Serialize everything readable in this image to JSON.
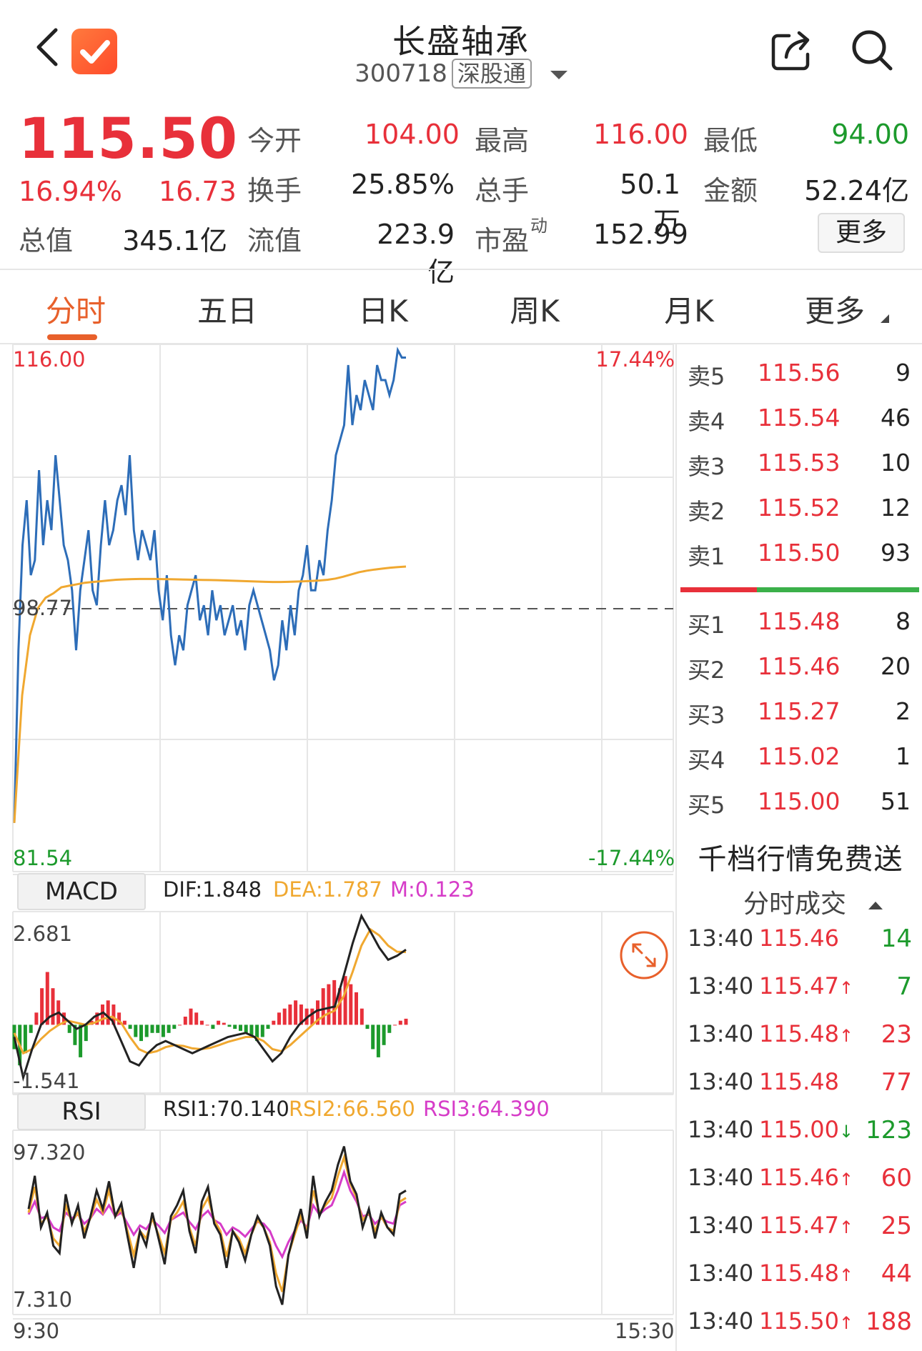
{
  "header": {
    "title": "长盛轴承",
    "code": "300718",
    "tag": "深股通"
  },
  "quote": {
    "price": "115.50",
    "pct_change": "16.94%",
    "change": "16.73",
    "total_mv_label": "总值",
    "total_mv": "345.1亿",
    "fields": [
      {
        "label": "今开",
        "value": "104.00",
        "color": "red"
      },
      {
        "label": "最高",
        "value": "116.00",
        "color": "red"
      },
      {
        "label": "最低",
        "value": "94.00",
        "color": "green"
      },
      {
        "label": "换手",
        "value": "25.85%",
        "color": "dark"
      },
      {
        "label": "总手",
        "value": "50.1万",
        "color": "dark"
      },
      {
        "label": "金额",
        "value": "52.24亿",
        "color": "dark"
      },
      {
        "label": "流值",
        "value": "223.9亿",
        "color": "dark"
      },
      {
        "label": "市盈",
        "value": "152.99",
        "color": "dark",
        "superscript": "动"
      }
    ],
    "more_button": "更多"
  },
  "tabs": [
    "分时",
    "五日",
    "日K",
    "周K",
    "月K",
    "更多"
  ],
  "active_tab": 0,
  "colors": {
    "up": "#e8303a",
    "down": "#1c9a2c",
    "accent": "#e8602b",
    "price_line": "#2d6db8",
    "avg_line": "#f0a830",
    "macd_m": "#d63cc8"
  },
  "intraday": {
    "y_max_label": "116.00",
    "y_min_label": "81.54",
    "pct_max_label": "17.44%",
    "pct_min_label": "-17.44%",
    "prev_close_label": "98.77",
    "time_start": "9:30",
    "time_end": "15:30",
    "prev_close": 98.77,
    "y_max": 116.0,
    "y_min": 81.54,
    "price": [
      84.5,
      96,
      103,
      106,
      101,
      102,
      108,
      103,
      106,
      104,
      109,
      106,
      103,
      102,
      100,
      96,
      100,
      102,
      104,
      100,
      99,
      103,
      106,
      103,
      104,
      106,
      107,
      105,
      109,
      104,
      102,
      104,
      103,
      102,
      104,
      100,
      98,
      101,
      97,
      95,
      97,
      96,
      99,
      100,
      101,
      98,
      99,
      97,
      100,
      98,
      99,
      97,
      98,
      99,
      97,
      98,
      96,
      99,
      100,
      99,
      98,
      97,
      96,
      94,
      95,
      98,
      96,
      99,
      97,
      100,
      101,
      103,
      100,
      100,
      102,
      101,
      104,
      106,
      109,
      110,
      111,
      115,
      111,
      113,
      112,
      114,
      113,
      112,
      115,
      114,
      114,
      113,
      114,
      116,
      115.5,
      115.5
    ],
    "avg": [
      84.5,
      93,
      97,
      98.8,
      99.5,
      99.8,
      100.2,
      100.3,
      100.4,
      100.5,
      100.55,
      100.6,
      100.65,
      100.7,
      100.72,
      100.74,
      100.75,
      100.75,
      100.75,
      100.74,
      100.73,
      100.72,
      100.71,
      100.7,
      100.69,
      100.68,
      100.67,
      100.65,
      100.63,
      100.61,
      100.6,
      100.58,
      100.56,
      100.55,
      100.55,
      100.56,
      100.58,
      100.6,
      100.62,
      100.65,
      100.7,
      100.78,
      100.9,
      101.05,
      101.2,
      101.3,
      101.38,
      101.44,
      101.5,
      101.54,
      101.58
    ]
  },
  "macd": {
    "tab_label": "MACD",
    "dif_label": "DIF:1.848",
    "dea_label": "DEA:1.787",
    "m_label": "M:0.123",
    "y_max_label": "2.681",
    "y_min_label": "-1.541",
    "y_max": 2.681,
    "y_min": -1.541,
    "hist": [
      -0.6,
      -1.0,
      -0.7,
      -0.2,
      0.3,
      0.9,
      1.3,
      0.9,
      0.6,
      0.3,
      -0.2,
      -0.5,
      -0.8,
      -0.4,
      0.1,
      0.3,
      0.5,
      0.6,
      0.5,
      0.3,
      0.1,
      -0.1,
      -0.3,
      -0.4,
      -0.3,
      -0.2,
      -0.2,
      -0.3,
      -0.2,
      -0.1,
      0.0,
      0.2,
      0.4,
      0.3,
      0.1,
      0.0,
      -0.1,
      0.1,
      0.05,
      -0.05,
      -0.1,
      -0.15,
      -0.2,
      -0.3,
      -0.4,
      -0.3,
      -0.1,
      0.1,
      0.3,
      0.4,
      0.5,
      0.6,
      0.5,
      0.4,
      0.4,
      0.6,
      0.9,
      1.0,
      1.1,
      0.9,
      1.2,
      1.0,
      0.8,
      0.4,
      -0.1,
      -0.6,
      -0.8,
      -0.5,
      -0.2,
      0.0,
      0.1,
      0.15
    ],
    "dif": [
      -0.3,
      -1.3,
      -0.6,
      0.0,
      0.2,
      0.3,
      0.1,
      -0.1,
      0.0,
      0.2,
      0.3,
      0.1,
      -0.4,
      -0.9,
      -1.0,
      -0.7,
      -0.5,
      -0.4,
      -0.5,
      -0.6,
      -0.7,
      -0.6,
      -0.5,
      -0.4,
      -0.3,
      -0.25,
      -0.2,
      -0.3,
      -0.6,
      -0.9,
      -0.7,
      -0.3,
      0.0,
      0.2,
      0.35,
      0.4,
      0.45,
      1.2,
      2.0,
      2.681,
      2.3,
      1.9,
      1.6,
      1.7,
      1.85
    ],
    "dea": [
      -0.2,
      -0.7,
      -0.6,
      -0.35,
      -0.15,
      0.0,
      0.1,
      0.05,
      0.0,
      0.05,
      0.15,
      0.2,
      0.05,
      -0.3,
      -0.6,
      -0.7,
      -0.65,
      -0.55,
      -0.5,
      -0.52,
      -0.58,
      -0.6,
      -0.57,
      -0.5,
      -0.42,
      -0.36,
      -0.3,
      -0.3,
      -0.4,
      -0.6,
      -0.65,
      -0.5,
      -0.3,
      -0.1,
      0.1,
      0.25,
      0.35,
      0.7,
      1.3,
      1.95,
      2.35,
      2.2,
      1.95,
      1.8,
      1.79
    ]
  },
  "rsi": {
    "tab_label": "RSI",
    "rsi1_label": "RSI1:70.140",
    "rsi2_label": "RSI2:66.560",
    "rsi3_label": "RSI3:64.390",
    "y_max_label": "97.320",
    "y_min_label": "7.310",
    "y_max": 97.32,
    "y_min": 7.31,
    "rsi1": [
      60,
      78,
      50,
      58,
      40,
      36,
      68,
      52,
      62,
      44,
      56,
      70,
      60,
      75,
      56,
      63,
      45,
      28,
      48,
      40,
      58,
      44,
      30,
      56,
      62,
      70,
      48,
      36,
      64,
      72,
      52,
      46,
      28,
      48,
      42,
      32,
      46,
      56,
      50,
      40,
      18,
      8,
      35,
      48,
      60,
      44,
      78,
      56,
      64,
      70,
      84,
      94,
      75,
      68,
      50,
      60,
      44,
      58,
      50,
      46,
      68,
      70
    ],
    "rsi2": [
      58,
      72,
      52,
      56,
      44,
      40,
      62,
      53,
      58,
      48,
      55,
      65,
      58,
      70,
      56,
      60,
      48,
      35,
      48,
      44,
      55,
      46,
      36,
      54,
      58,
      64,
      50,
      40,
      60,
      66,
      54,
      48,
      34,
      48,
      44,
      36,
      46,
      54,
      50,
      42,
      25,
      15,
      35,
      46,
      56,
      48,
      70,
      58,
      62,
      66,
      78,
      88,
      74,
      66,
      54,
      58,
      48,
      56,
      50,
      48,
      64,
      66
    ],
    "rsi3": [
      57,
      64,
      55,
      56,
      50,
      48,
      58,
      55,
      57,
      52,
      55,
      60,
      57,
      62,
      56,
      58,
      52,
      46,
      51,
      49,
      54,
      51,
      47,
      54,
      56,
      58,
      53,
      49,
      56,
      59,
      54,
      52,
      46,
      50,
      48,
      45,
      49,
      53,
      52,
      48,
      40,
      34,
      42,
      48,
      54,
      50,
      62,
      57,
      60,
      62,
      70,
      80,
      70,
      64,
      56,
      57,
      52,
      55,
      53,
      52,
      62,
      64
    ]
  },
  "order_book": {
    "asks": [
      {
        "label": "卖5",
        "price": "115.56",
        "vol": "9"
      },
      {
        "label": "卖4",
        "price": "115.54",
        "vol": "46"
      },
      {
        "label": "卖3",
        "price": "115.53",
        "vol": "10"
      },
      {
        "label": "卖2",
        "price": "115.52",
        "vol": "12"
      },
      {
        "label": "卖1",
        "price": "115.50",
        "vol": "93"
      }
    ],
    "bids": [
      {
        "label": "买1",
        "price": "115.48",
        "vol": "8"
      },
      {
        "label": "买2",
        "price": "115.46",
        "vol": "20"
      },
      {
        "label": "买3",
        "price": "115.27",
        "vol": "2"
      },
      {
        "label": "买4",
        "price": "115.02",
        "vol": "1"
      },
      {
        "label": "买5",
        "price": "115.00",
        "vol": "51"
      }
    ],
    "buy_ratio": 0.32
  },
  "promo": "千档行情免费送",
  "trades_header": "分时成交",
  "trades": [
    {
      "time": "13:40",
      "price": "115.46",
      "arrow": "",
      "vol": "14",
      "dir": "down"
    },
    {
      "time": "13:40",
      "price": "115.47",
      "arrow": "↑",
      "vol": "7",
      "dir": "down"
    },
    {
      "time": "13:40",
      "price": "115.48",
      "arrow": "↑",
      "vol": "23",
      "dir": "up"
    },
    {
      "time": "13:40",
      "price": "115.48",
      "arrow": "",
      "vol": "77",
      "dir": "up"
    },
    {
      "time": "13:40",
      "price": "115.00",
      "arrow": "↓",
      "vol": "123",
      "dir": "down"
    },
    {
      "time": "13:40",
      "price": "115.46",
      "arrow": "↑",
      "vol": "60",
      "dir": "up"
    },
    {
      "time": "13:40",
      "price": "115.47",
      "arrow": "↑",
      "vol": "25",
      "dir": "up"
    },
    {
      "time": "13:40",
      "price": "115.48",
      "arrow": "↑",
      "vol": "44",
      "dir": "up"
    },
    {
      "time": "13:40",
      "price": "115.50",
      "arrow": "↑",
      "vol": "188",
      "dir": "up"
    }
  ]
}
